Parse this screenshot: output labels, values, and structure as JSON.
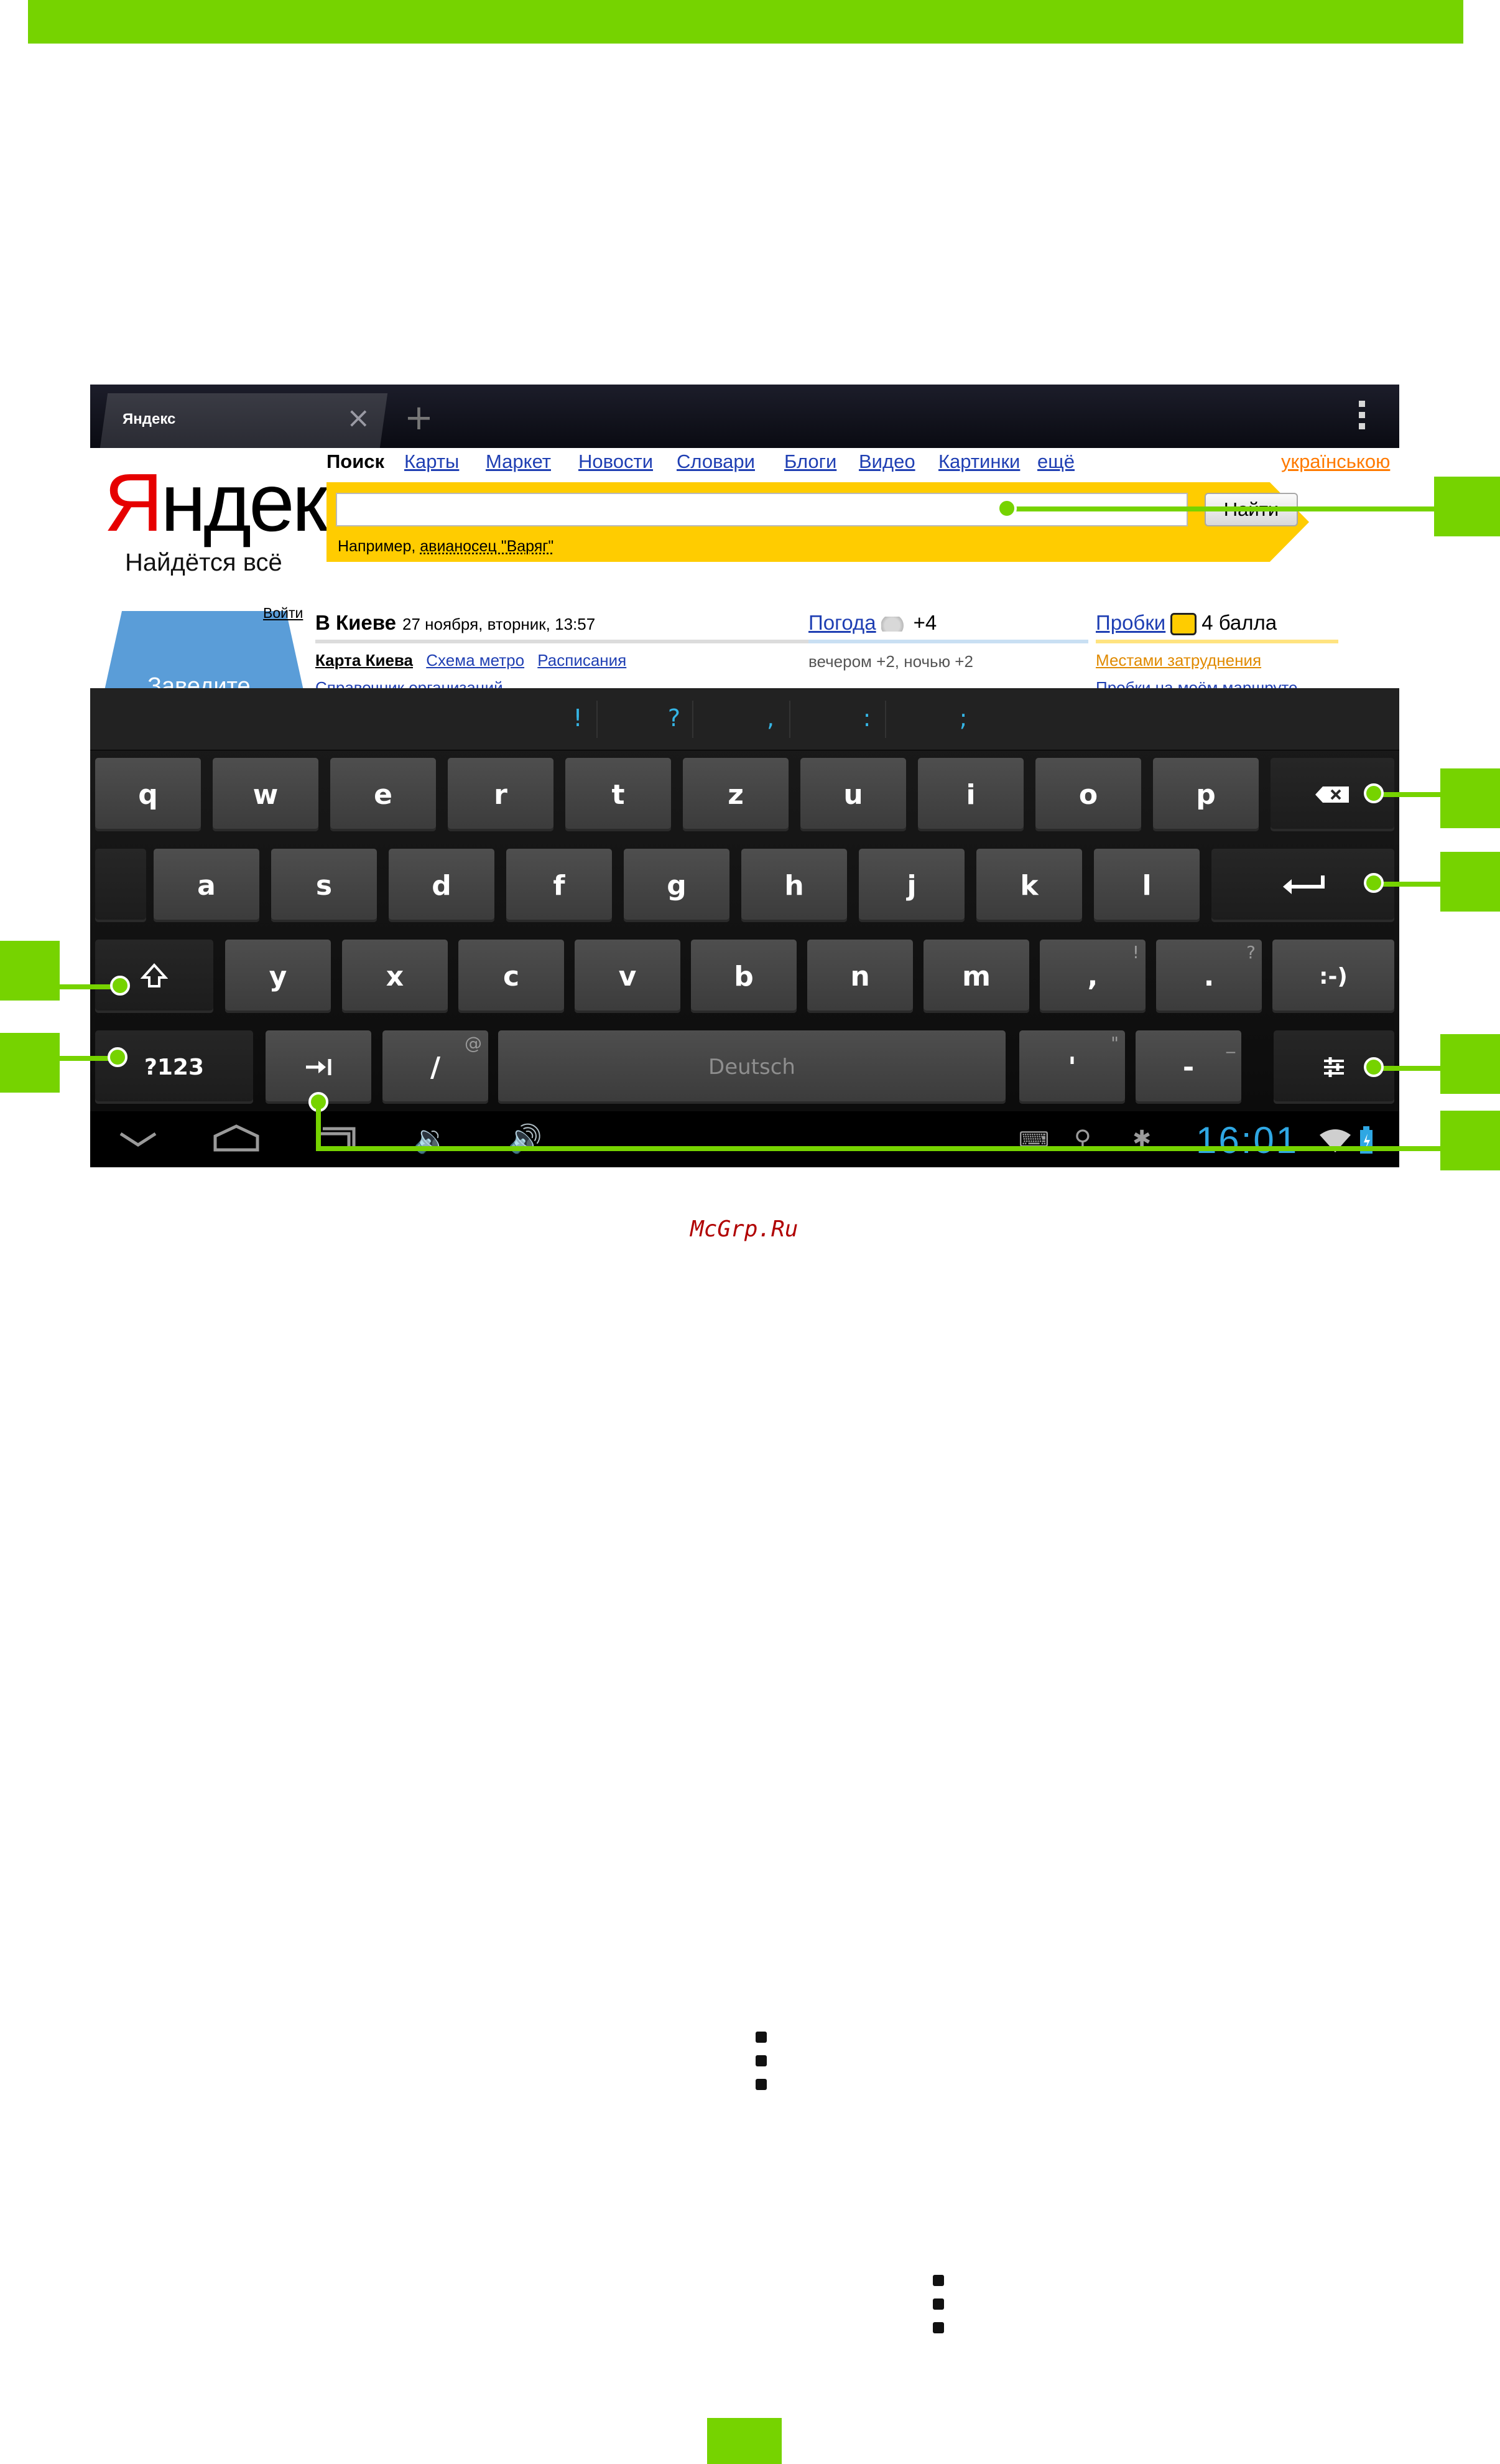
{
  "colors": {
    "accent": "#76d300",
    "keyboard_blue": "#35b5e5",
    "yandex_yellow": "#ffcc00",
    "yandex_red": "#e60000"
  },
  "browser": {
    "tab_title": "Яндекс",
    "tab_close_icon": "×",
    "new_tab_icon": "+"
  },
  "yandex": {
    "logo_first": "Я",
    "logo_rest": "ндекс",
    "slogan": "Найдётся всё",
    "nav": [
      "Поиск",
      "Карты",
      "Маркет",
      "Новости",
      "Словари",
      "Блоги",
      "Видео",
      "Картинки",
      "ещё"
    ],
    "lang_link": "українською",
    "search_value": "",
    "search_button": "Найти",
    "example_prefix": "Например, ",
    "example_link": "авианосец \"Варяг\"",
    "login": "Войти",
    "tile_text": "Заведите",
    "city": "В Киеве",
    "date": "27 ноября, вторник, 13:57",
    "city_links": [
      "Карта Киева",
      "Схема метро",
      "Расписания"
    ],
    "city_cut": "Справочник организаций",
    "weather_label": "Погода",
    "weather_temp": "+4",
    "weather_sub": "вечером +2, ночью +2",
    "traffic_label": "Пробки",
    "traffic_value": "4 балла",
    "traffic_sub": "Местами затруднения",
    "traffic_cut": "Пробки на моём маршруте"
  },
  "keyboard": {
    "suggestions": [
      "!",
      "?",
      ",",
      ":",
      ";"
    ],
    "row1": [
      "q",
      "w",
      "e",
      "r",
      "t",
      "z",
      "u",
      "i",
      "o",
      "p"
    ],
    "row2": [
      "a",
      "s",
      "d",
      "f",
      "g",
      "h",
      "j",
      "k",
      "l"
    ],
    "row3": [
      "y",
      "x",
      "c",
      "v",
      "b",
      "n",
      "m",
      ",",
      "."
    ],
    "row3_alts": {
      "comma": "!",
      "period": "?"
    },
    "smiley": ":-)",
    "symbols": "?123",
    "slash": "/",
    "slash_alt": "@",
    "space": "Deutsch",
    "apostrophe": "'",
    "apostrophe_alt": "\"",
    "dash": "-",
    "dash_alt": "_",
    "icons": {
      "backspace": "backspace-icon",
      "enter": "enter-icon",
      "shift": "shift-icon",
      "tab": "tab-icon",
      "settings": "settings-icon"
    }
  },
  "system_bar": {
    "clock": "16:01"
  },
  "watermark": "McGrp.Ru"
}
